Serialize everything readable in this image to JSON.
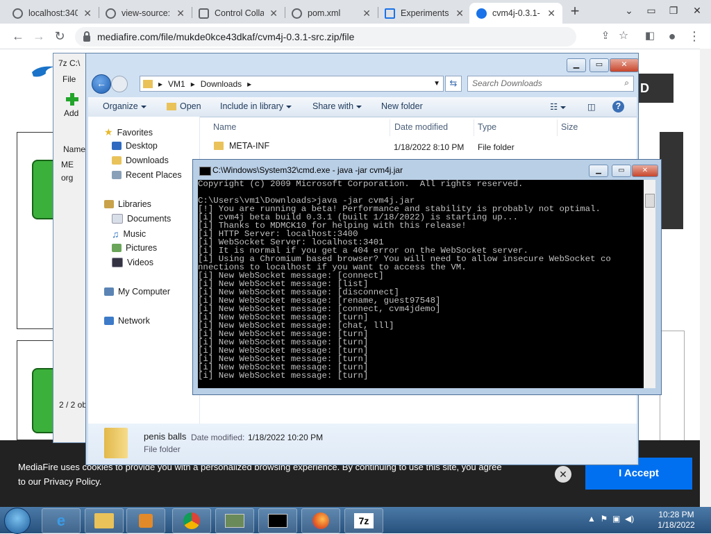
{
  "browser": {
    "tabs": [
      {
        "label": "localhost:340",
        "active": false
      },
      {
        "label": "view-source:",
        "active": false
      },
      {
        "label": "Control Colla",
        "active": false
      },
      {
        "label": "pom.xml",
        "active": false
      },
      {
        "label": "Experiments",
        "active": false
      },
      {
        "label": "cvm4j-0.3.1-",
        "active": true
      }
    ],
    "new_tab": "+",
    "url": "mediafire.com/file/mukde0kce43dkaf/cvm4j-0.3.1-src.zip/file"
  },
  "mediafire": {
    "download_label": "D",
    "cookie_text": "MediaFire uses cookies to provide you with a personalized browsing experience. By continuing to use this site, you agree to our Privacy Policy.",
    "accept_label": "I Accept",
    "close_glyph": "✕"
  },
  "zip": {
    "title": "7z C:\\",
    "menu_file": "File",
    "add_label": "Add",
    "name_header": "Name",
    "rows": [
      "ME",
      "org"
    ],
    "status": "2 / 2 ob"
  },
  "explorer": {
    "address": [
      "VM1",
      "Downloads"
    ],
    "search_placeholder": "Search Downloads",
    "commands": [
      "Organize",
      "Open",
      "Include in library",
      "Share with",
      "New folder"
    ],
    "nav": {
      "favorites": "Favorites",
      "fav_items": [
        "Desktop",
        "Downloads",
        "Recent Places"
      ],
      "libraries": "Libraries",
      "lib_items": [
        "Documents",
        "Music",
        "Pictures",
        "Videos"
      ],
      "computer": "My Computer",
      "network": "Network"
    },
    "columns": [
      "Name",
      "Date modified",
      "Type",
      "Size"
    ],
    "files": [
      {
        "name": "META-INF",
        "date": "1/18/2022 8:10 PM",
        "type": "File folder"
      }
    ],
    "details": {
      "name": "penis balls",
      "date_label": "Date modified:",
      "date": "1/18/2022 10:20 PM",
      "type": "File folder"
    }
  },
  "cmd": {
    "title": "C:\\Windows\\System32\\cmd.exe - java  -jar cvm4j.jar",
    "lines": [
      "Copyright (c) 2009 Microsoft Corporation.  All rights reserved.",
      "",
      "C:\\Users\\vm1\\Downloads>java -jar cvm4j.jar",
      "[!] You are running a beta! Performance and stability is probably not optimal.",
      "[i] cvm4j beta build 0.3.1 (built 1/18/2022) is starting up...",
      "[i] Thanks to MDMCK10 for helping with this release!",
      "[i] HTTP Server: localhost:3400",
      "[i] WebSocket Server: localhost:3401",
      "[i] It is normal if you get a 404 error on the WebSocket server.",
      "[i] Using a Chromium based browser? You will need to allow insecure WebSocket co",
      "nnections to localhost if you want to access the VM.",
      "[i] New WebSocket message: [connect]",
      "[i] New WebSocket message: [list]",
      "[i] New WebSocket message: [disconnect]",
      "[i] New WebSocket message: [rename, guest97548]",
      "[i] New WebSocket message: [connect, cvm4jdemo]",
      "[i] New WebSocket message: [turn]",
      "[i] New WebSocket message: [chat, lll]",
      "[i] New WebSocket message: [turn]",
      "[i] New WebSocket message: [turn]",
      "[i] New WebSocket message: [turn]",
      "[i] New WebSocket message: [turn]",
      "[i] New WebSocket message: [turn]",
      "[i] New WebSocket message: [turn]"
    ]
  },
  "taskbar": {
    "time": "10:28 PM",
    "date": "1/18/2022"
  }
}
